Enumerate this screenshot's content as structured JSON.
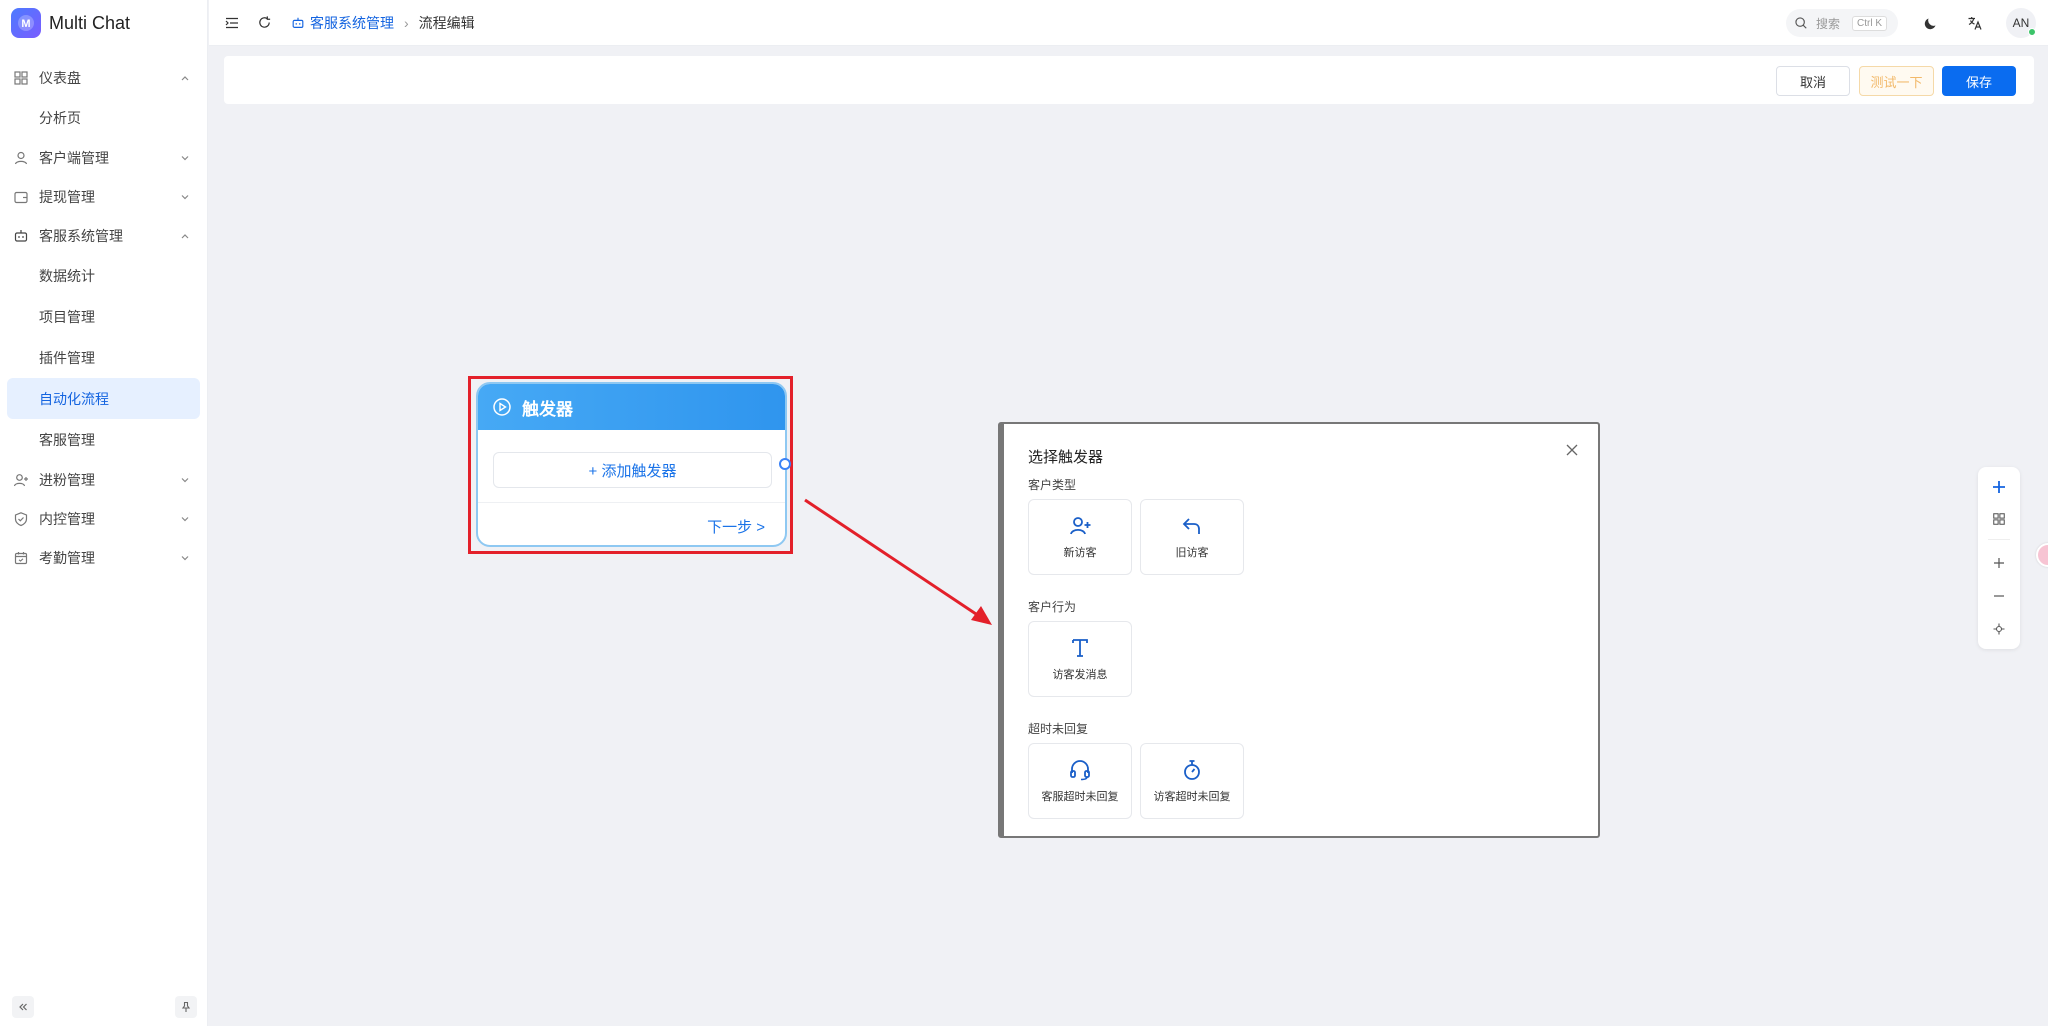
{
  "app": {
    "name": "Multi Chat",
    "logo_letter": "M"
  },
  "sidebar": {
    "items": [
      {
        "label": "仪表盘",
        "type": "group",
        "icon": "dashboard-icon",
        "expanded": true
      },
      {
        "label": "分析页",
        "type": "sub"
      },
      {
        "label": "客户端管理",
        "type": "group",
        "icon": "user-icon",
        "expanded": false
      },
      {
        "label": "提现管理",
        "type": "group",
        "icon": "wallet-icon",
        "expanded": false
      },
      {
        "label": "客服系统管理",
        "type": "group",
        "icon": "robot-icon",
        "expanded": true
      },
      {
        "label": "数据统计",
        "type": "sub"
      },
      {
        "label": "项目管理",
        "type": "sub"
      },
      {
        "label": "插件管理",
        "type": "sub"
      },
      {
        "label": "自动化流程",
        "type": "sub",
        "active": true
      },
      {
        "label": "客服管理",
        "type": "sub"
      },
      {
        "label": "进粉管理",
        "type": "group",
        "icon": "user-plus-icon",
        "expanded": false
      },
      {
        "label": "内控管理",
        "type": "group",
        "icon": "shield-icon",
        "expanded": false
      },
      {
        "label": "考勤管理",
        "type": "group",
        "icon": "calendar-icon",
        "expanded": false
      }
    ]
  },
  "header": {
    "breadcrumb": {
      "parent": "客服系统管理",
      "current": "流程编辑"
    },
    "search": {
      "placeholder": "搜索",
      "shortcut": "Ctrl K"
    },
    "avatar": "AN"
  },
  "toolbar": {
    "cancel_label": "取消",
    "test_label": "测试一下",
    "save_label": "保存"
  },
  "trigger_node": {
    "title": "触发器",
    "add_label": "+ 添加触发器",
    "next_label": "下一步 >"
  },
  "dialog": {
    "title": "选择触发器",
    "sections": [
      {
        "title": "客户类型",
        "options": [
          {
            "label": "新访客",
            "icon": "user-plus-icon"
          },
          {
            "label": "旧访客",
            "icon": "return-arrow-icon"
          }
        ]
      },
      {
        "title": "客户行为",
        "options": [
          {
            "label": "访客发消息",
            "icon": "text-t-icon"
          }
        ]
      },
      {
        "title": "超时未回复",
        "options": [
          {
            "label": "客服超时未回复",
            "icon": "headset-icon"
          },
          {
            "label": "访客超时未回复",
            "icon": "stopwatch-icon"
          }
        ]
      }
    ]
  },
  "colors": {
    "primary": "#0a6cf0",
    "annotation_red": "#e3202a",
    "node_header": "#3a9ff0"
  }
}
